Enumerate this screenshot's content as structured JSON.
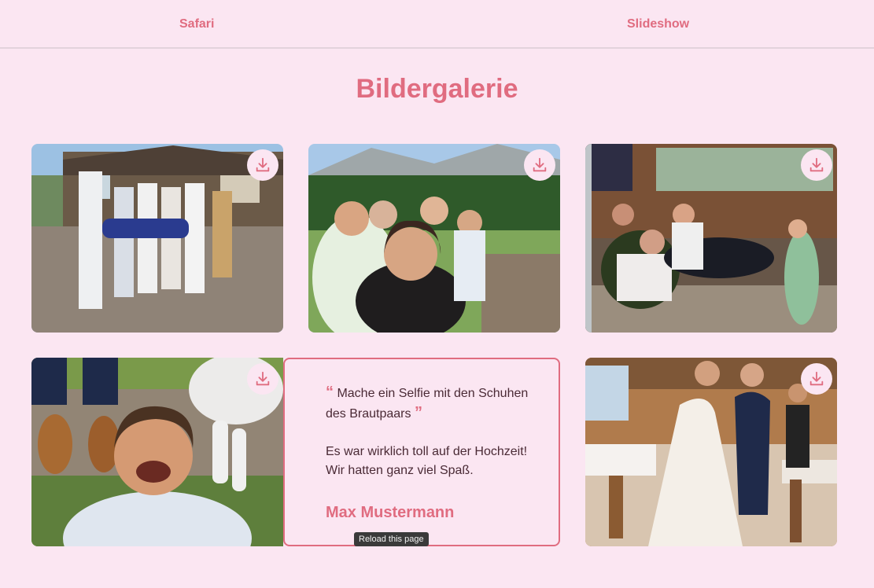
{
  "nav": {
    "safari_label": "Safari",
    "slideshow_label": "Slideshow"
  },
  "page": {
    "title": "Bildergalerie"
  },
  "photos": [
    {
      "name": "photo-group-lift"
    },
    {
      "name": "photo-selfie-mountains"
    },
    {
      "name": "photo-musicians-bar"
    },
    {
      "name": "photo-shoes-selfie"
    },
    {
      "name": "photo-bride-guest"
    }
  ],
  "quote": {
    "text": "Mache ein Selfie mit den Schuhen des Brautpaars",
    "body_line1": "Es war wirklich toll auf der Hochzeit!",
    "body_line2": "Wir hatten ganz viel Spaß.",
    "author": "Max Mustermann"
  },
  "tooltip": {
    "text": "Reload this page"
  },
  "icons": {
    "download": "download-icon"
  },
  "colors": {
    "accent": "#e06c80",
    "background": "#fbe6f2"
  }
}
